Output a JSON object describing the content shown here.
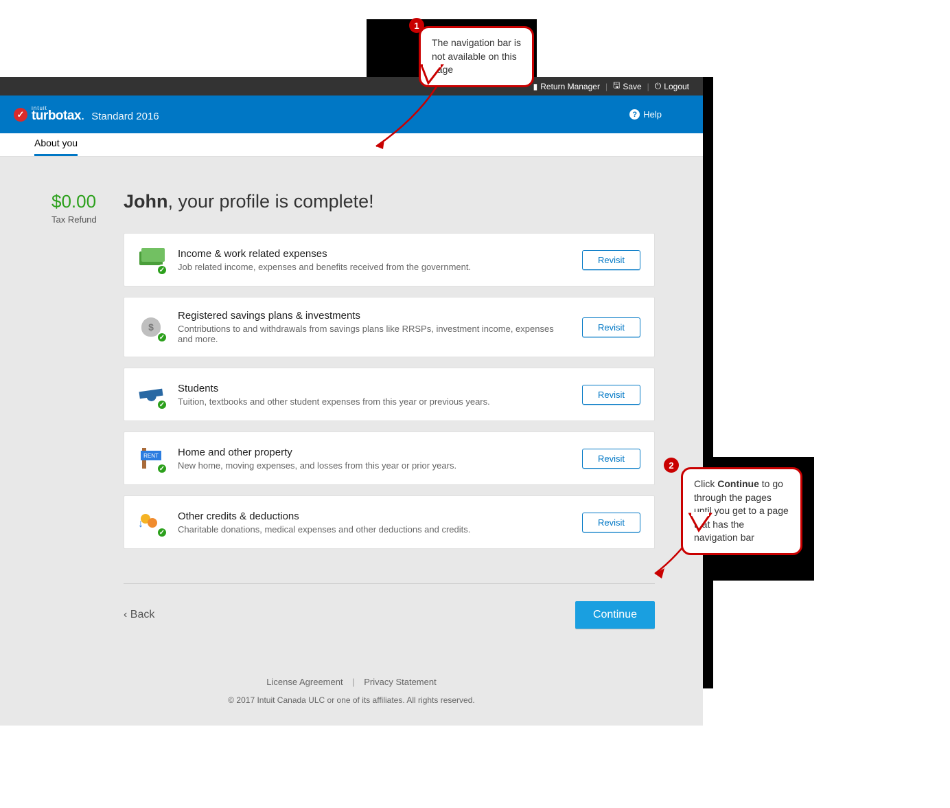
{
  "topbar": {
    "return_manager": "Return Manager",
    "save": "Save",
    "logout": "Logout"
  },
  "brand": {
    "intuit": "intuit",
    "name": "turbotax",
    "edition": "Standard 2016",
    "help": "Help"
  },
  "tab": {
    "label": "About you"
  },
  "refund": {
    "amount": "$0.00",
    "label": "Tax Refund"
  },
  "headline": {
    "name": "John",
    "rest": ", your profile is complete!"
  },
  "cards": [
    {
      "title": "Income & work related expenses",
      "desc": "Job related income, expenses and benefits received from the government.",
      "btn": "Revisit"
    },
    {
      "title": "Registered savings plans & investments",
      "desc": "Contributions to and withdrawals from savings plans like RRSPs, investment income, expenses and more.",
      "btn": "Revisit"
    },
    {
      "title": "Students",
      "desc": "Tuition, textbooks and other student expenses from this year or previous years.",
      "btn": "Revisit"
    },
    {
      "title": "Home and other property",
      "desc": "New home, moving expenses, and losses from this year or prior years.",
      "btn": "Revisit"
    },
    {
      "title": "Other credits & deductions",
      "desc": "Charitable donations, medical expenses and other deductions and credits.",
      "btn": "Revisit"
    }
  ],
  "nav": {
    "back": "‹ Back",
    "continue": "Continue"
  },
  "footer": {
    "license": "License Agreement",
    "privacy": "Privacy Statement",
    "copyright": "© 2017 Intuit Canada ULC or one of its affiliates. All rights reserved."
  },
  "callouts": {
    "c1": {
      "num": "1",
      "text": "The navigation bar is not available on this page"
    },
    "c2": {
      "num": "2",
      "pre": "Click ",
      "bold": "Continue",
      "post": " to go through the pages until you get to a page that has the navigation bar"
    }
  }
}
